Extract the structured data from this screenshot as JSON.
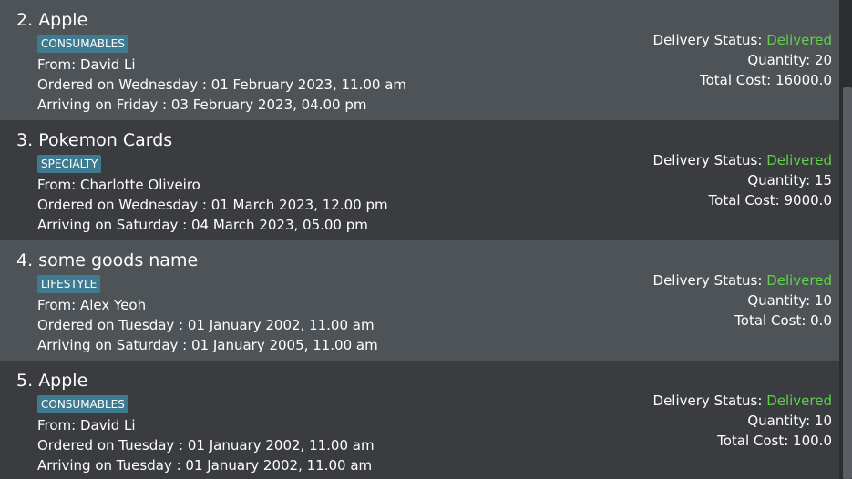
{
  "orders": [
    {
      "index": "2.",
      "name": "Apple",
      "tag": "CONSUMABLES",
      "from": "From: David Li",
      "ordered": "Ordered on Wednesday : 01 February 2023, 11.00 am",
      "arriving": "Arriving on Friday : 03 February 2023, 04.00 pm",
      "status_label": "Delivery Status: ",
      "status": "Delivered",
      "quantity": "Quantity: 20",
      "total_cost": "Total Cost: 16000.0"
    },
    {
      "index": "3.",
      "name": "Pokemon Cards",
      "tag": "SPECIALTY",
      "from": "From: Charlotte Oliveiro",
      "ordered": "Ordered on Wednesday : 01 March 2023, 12.00 pm",
      "arriving": "Arriving on Saturday : 04 March 2023, 05.00 pm",
      "status_label": "Delivery Status: ",
      "status": "Delivered",
      "quantity": "Quantity: 15",
      "total_cost": "Total Cost: 9000.0"
    },
    {
      "index": "4.",
      "name": "some goods name",
      "tag": "LIFESTYLE",
      "from": "From: Alex Yeoh",
      "ordered": "Ordered on Tuesday : 01 January 2002, 11.00 am",
      "arriving": "Arriving on Saturday : 01 January 2005, 11.00 am",
      "status_label": "Delivery Status: ",
      "status": "Delivered",
      "quantity": "Quantity: 10",
      "total_cost": "Total Cost: 0.0"
    },
    {
      "index": "5.",
      "name": "Apple",
      "tag": "CONSUMABLES",
      "from": "From: David Li",
      "ordered": "Ordered on Tuesday : 01 January 2002, 11.00 am",
      "arriving": "Arriving on Tuesday : 01 January 2002, 11.00 am",
      "status_label": "Delivery Status: ",
      "status": "Delivered",
      "quantity": "Quantity: 10",
      "total_cost": "Total Cost: 100.0"
    }
  ],
  "colors": {
    "row_light": "#4e5357",
    "row_dark": "#3a3c3f",
    "tag_bg": "#3e7b91",
    "status_delivered": "#5fd14a"
  }
}
